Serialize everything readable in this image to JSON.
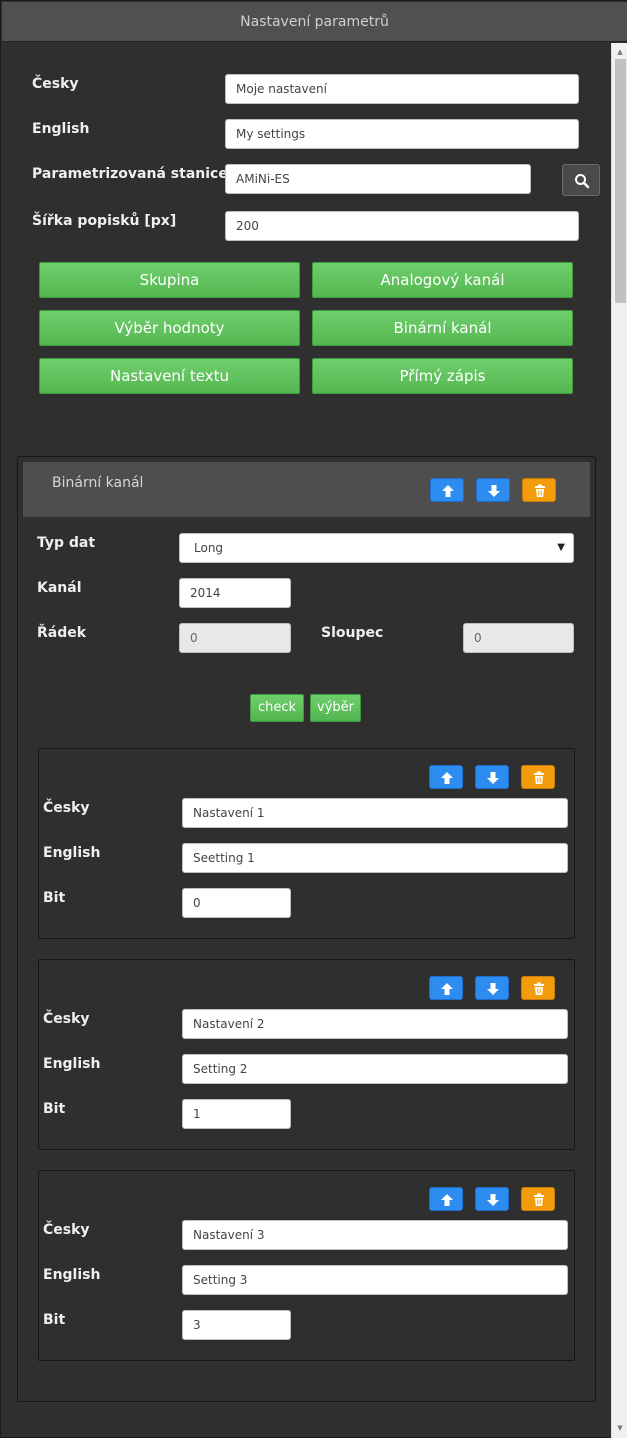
{
  "window": {
    "title": "Nastavení parametrů"
  },
  "form": {
    "cesky_label": "Česky",
    "cesky_value": "Moje nastavení",
    "english_label": "English",
    "english_value": "My settings",
    "station_label": "Parametrizovaná stanice",
    "station_value": "AMiNi-ES",
    "width_label": "Šířka popisků [px]",
    "width_value": "200"
  },
  "add_buttons": [
    "Skupina",
    "Analogový kanál",
    "Výběr hodnoty",
    "Binární kanál",
    "Nastavení textu",
    "Přímý zápis"
  ],
  "binary_channel": {
    "title": "Binární kanál",
    "data_type_label": "Typ dat",
    "data_type_value": "Long",
    "channel_label": "Kanál",
    "channel_value": "2014",
    "row_label": "Řádek",
    "row_value": "0",
    "column_label": "Sloupec",
    "column_value": "0",
    "check_label": "check",
    "select_label": "výběr",
    "items": [
      {
        "cesky_label": "Česky",
        "cesky_value": "Nastavení 1",
        "english_label": "English",
        "english_value": "Seetting 1",
        "bit_label": "Bit",
        "bit_value": "0"
      },
      {
        "cesky_label": "Česky",
        "cesky_value": "Nastavení 2",
        "english_label": "English",
        "english_value": "Setting 2",
        "bit_label": "Bit",
        "bit_value": "1"
      },
      {
        "cesky_label": "Česky",
        "cesky_value": "Nastavení 3",
        "english_label": "English",
        "english_value": "Setting 3",
        "bit_label": "Bit",
        "bit_value": "3"
      }
    ]
  },
  "colors": {
    "accent_green": "#5cbf59",
    "accent_blue": "#2d8cf0",
    "accent_orange": "#f29b0b",
    "background": "#2f2f2f"
  },
  "icons": {
    "search": "search-icon",
    "up": "arrow-up-icon",
    "down": "arrow-down-icon",
    "delete": "trash-icon"
  }
}
